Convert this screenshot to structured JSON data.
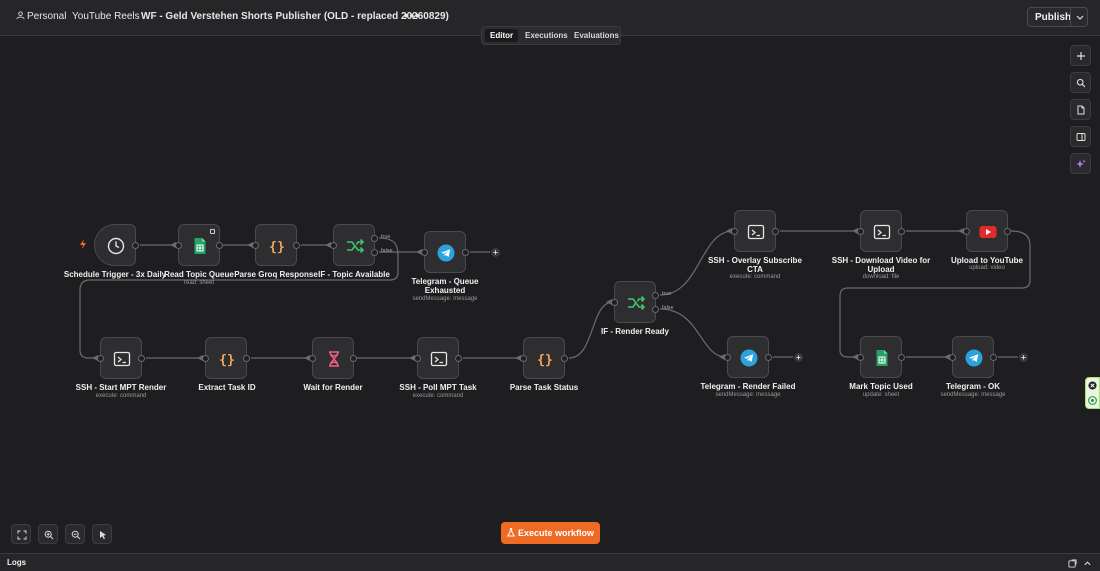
{
  "header": {
    "project": "Personal",
    "folder": "YouTube Reels",
    "workflow_name": "WF - Geld Verstehen Shorts Publisher (OLD - replaced 20260829)",
    "more_label": "•••",
    "publish_label": "Publish"
  },
  "tabs": [
    {
      "label": "Editor",
      "active": true
    },
    {
      "label": "Executions",
      "active": false
    },
    {
      "label": "Evaluations",
      "active": false
    }
  ],
  "nodes": {
    "schedule": {
      "label": "Schedule Trigger - 3x Daily",
      "sub": ""
    },
    "read_topic": {
      "label": "Read Topic Queue",
      "sub": "read: sheet"
    },
    "parse_groq": {
      "label": "Parse Groq Response",
      "sub": ""
    },
    "if_topic": {
      "label": "IF - Topic Available",
      "sub": ""
    },
    "tg_queue": {
      "label": "Telegram - Queue Exhausted",
      "sub": "sendMessage: message"
    },
    "ssh_start": {
      "label": "SSH - Start MPT Render",
      "sub": "execute: command"
    },
    "extract_task": {
      "label": "Extract Task ID",
      "sub": ""
    },
    "wait_render": {
      "label": "Wait for Render",
      "sub": ""
    },
    "ssh_poll": {
      "label": "SSH - Poll MPT Task",
      "sub": "execute: command"
    },
    "parse_status": {
      "label": "Parse Task Status",
      "sub": ""
    },
    "if_render": {
      "label": "IF - Render Ready",
      "sub": ""
    },
    "ssh_overlay": {
      "label": "SSH - Overlay Subscribe CTA",
      "sub": "execute: command"
    },
    "ssh_download": {
      "label": "SSH - Download Video for Upload",
      "sub": "download: file"
    },
    "upload_yt": {
      "label": "Upload to YouTube",
      "sub": "upload: video"
    },
    "tg_failed": {
      "label": "Telegram - Render Failed",
      "sub": "sendMessage: message"
    },
    "mark_used": {
      "label": "Mark Topic Used",
      "sub": "update: sheet"
    },
    "tg_ok": {
      "label": "Telegram - OK",
      "sub": "sendMessage: message"
    }
  },
  "branches": {
    "true_label": "true",
    "false_label": "false"
  },
  "execute_label": "Execute workflow",
  "logs_label": "Logs",
  "colors": {
    "accent": "#ef6a24",
    "sheets_green": "#21a464",
    "code_orange": "#f4a75a",
    "if_green": "#3ec46d",
    "telegram_blue": "#2aa3dd",
    "wait_pink": "#ef5b86",
    "youtube_red": "#e12a2a"
  }
}
